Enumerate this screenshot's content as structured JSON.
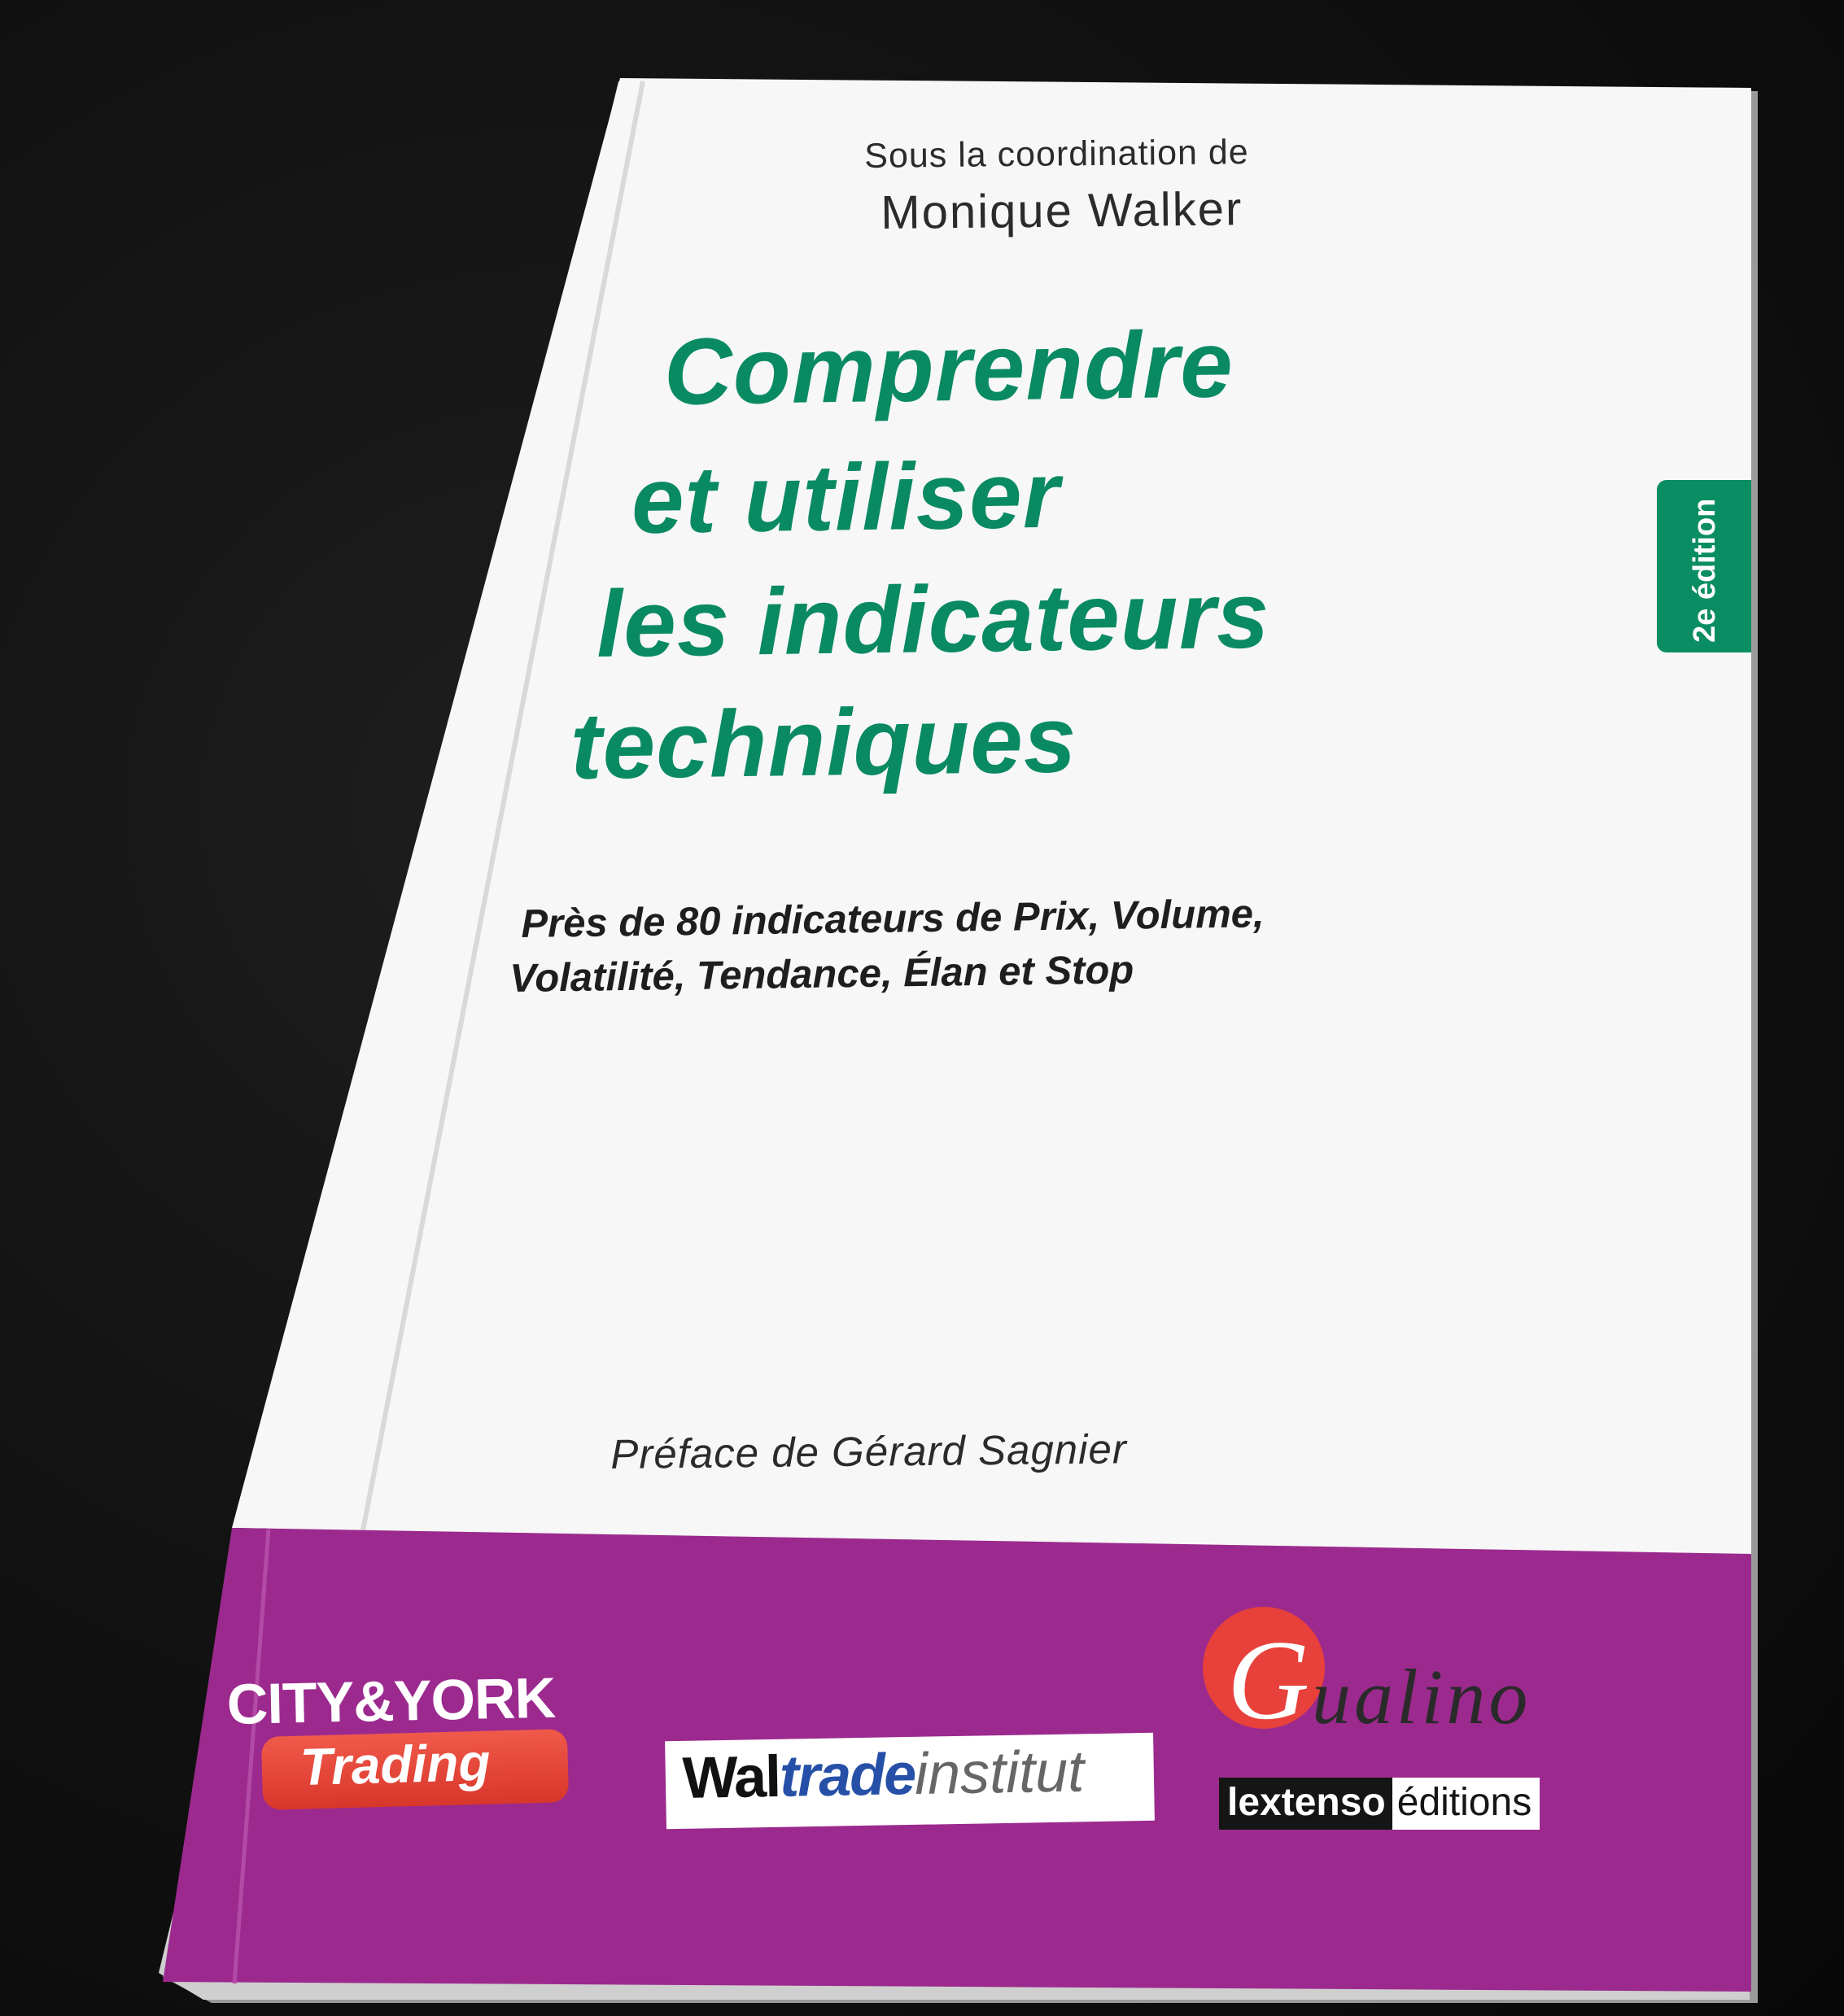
{
  "cover": {
    "coordination_line": "Sous la coordination de",
    "author": "Monique Walker",
    "title_lines": [
      "Comprendre",
      "et utiliser",
      "les indicateurs",
      "techniques"
    ],
    "subtitle_lines": [
      "Près de 80 indicateurs de Prix, Volume,",
      "Volatilité, Tendance, Élan et Stop"
    ],
    "edition_badge": "2e édition",
    "preface": "Préface de Gérard Sagnier"
  },
  "logos": {
    "city_york": "CITY&YORK",
    "city_york_trading": "Trading",
    "waltrade_prefix": "Wal",
    "waltrade_mid": "trade",
    "waltrade_suffix": "institut",
    "gualino_initial": "G",
    "gualino_rest": "ualino",
    "lextenso_left": "lextenso",
    "lextenso_right": "éditions"
  },
  "colors": {
    "title_green": "#0a8a62",
    "band_purple": "#9c2a8e",
    "background_dark": "#121212",
    "cover_white": "#f6f6f6"
  }
}
